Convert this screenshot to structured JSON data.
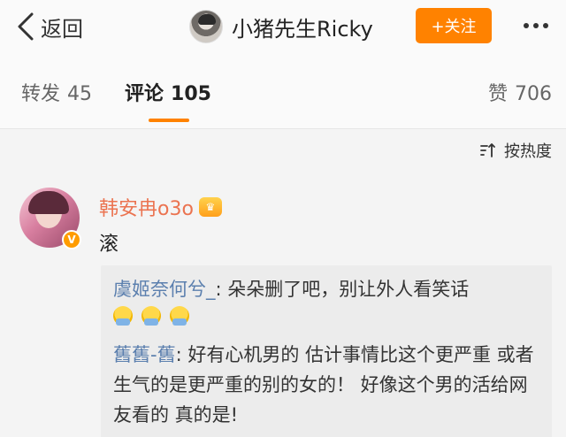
{
  "header": {
    "back_label": "返回",
    "username": "小猪先生Ricky",
    "follow_label": "+关注"
  },
  "tabs": {
    "repost_label": "转发",
    "repost_count": "45",
    "comment_label": "评论",
    "comment_count": "105",
    "like_label": "赞",
    "like_count": "706"
  },
  "sort": {
    "label": "按热度"
  },
  "comment": {
    "author": "韩安冉o3o",
    "text": "滚",
    "replies": [
      {
        "name": "虞姬奈何兮_",
        "text": ": 朵朵删了吧，别让外人看笑话"
      },
      {
        "name": "舊舊-舊",
        "text": ": 好有心机男的 估计事情比这个更严重 或者生气的是更严重的别的女的！ 好像这个男的活给网友看的 真的是!"
      }
    ]
  },
  "colors": {
    "accent": "#ff8200",
    "author_name": "#eb7350",
    "reply_name": "#5b7fae"
  }
}
